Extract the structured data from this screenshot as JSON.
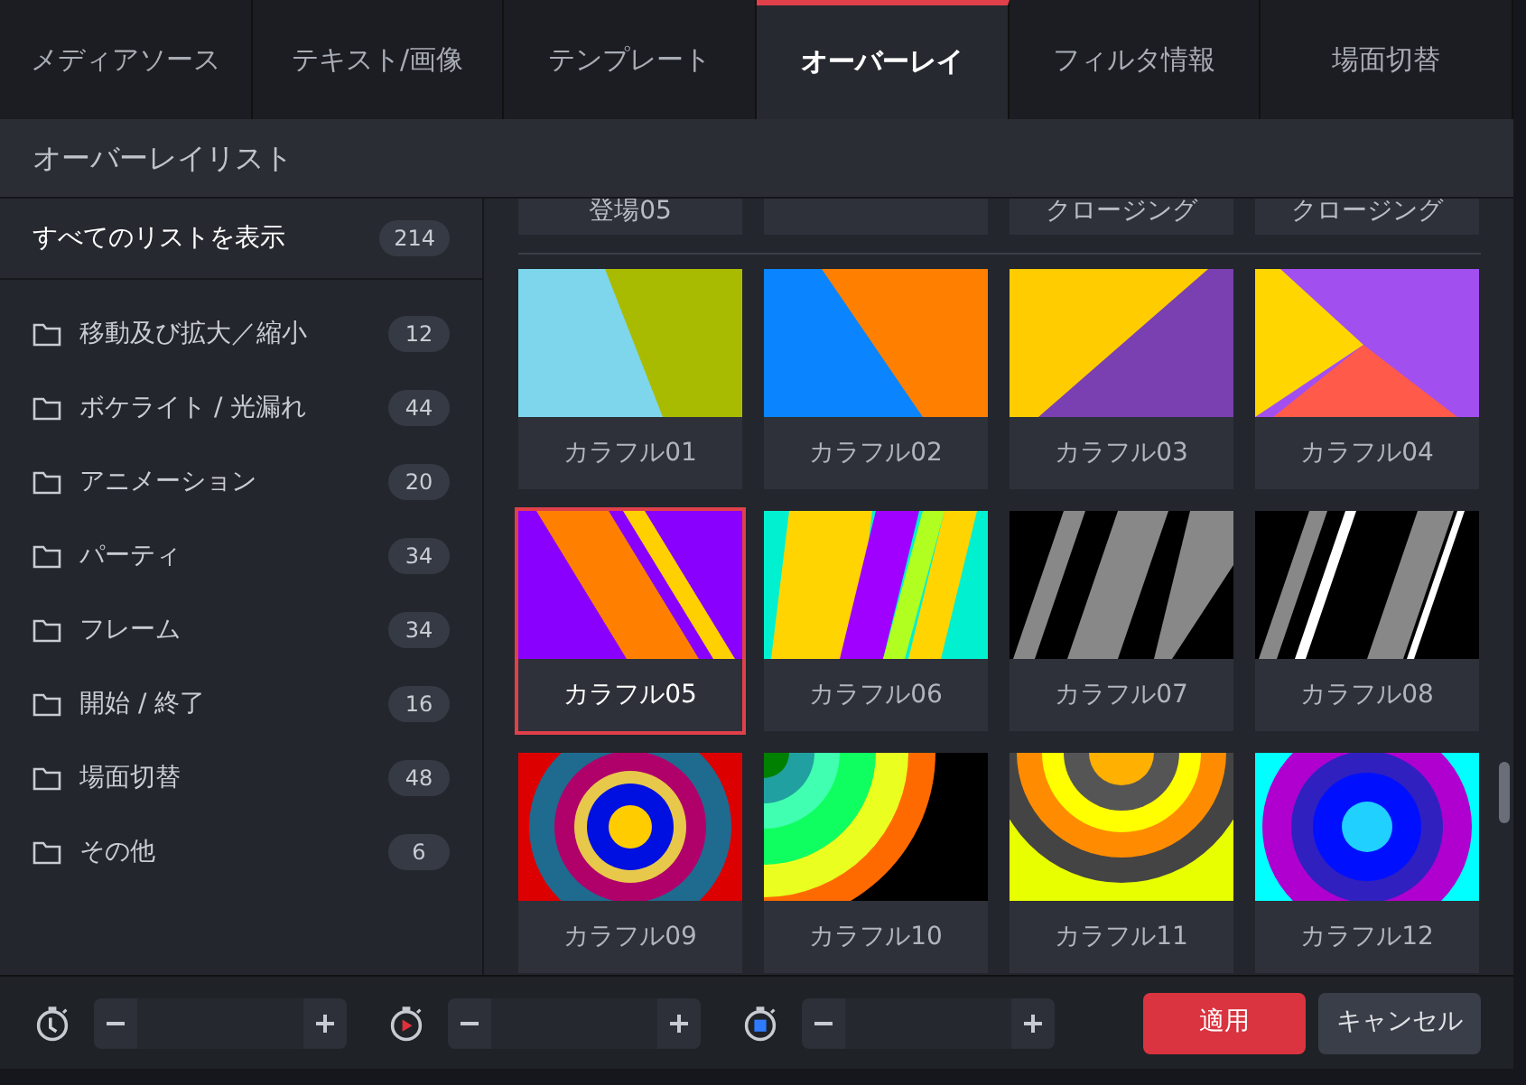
{
  "tabs": [
    {
      "label": "メディアソース",
      "selected": false
    },
    {
      "label": "テキスト/画像",
      "selected": false
    },
    {
      "label": "テンプレート",
      "selected": false
    },
    {
      "label": "オーバーレイ",
      "selected": true
    },
    {
      "label": "フィルタ情報",
      "selected": false
    },
    {
      "label": "場面切替",
      "selected": false
    }
  ],
  "list_header": "オーバーレイリスト",
  "sidebar": {
    "all": {
      "label": "すべてのリストを表示",
      "count": "214",
      "selected": false
    },
    "items": [
      {
        "label": "移動及び拡大／縮小",
        "count": "12"
      },
      {
        "label": "ボケライト / 光漏れ",
        "count": "44"
      },
      {
        "label": "アニメーション",
        "count": "20"
      },
      {
        "label": "パーティ",
        "count": "34"
      },
      {
        "label": "フレーム",
        "count": "34"
      },
      {
        "label": "開始 / 終了",
        "count": "16"
      },
      {
        "label": "場面切替",
        "count": "48"
      },
      {
        "label": "その他",
        "count": "6"
      }
    ]
  },
  "partial_row": [
    {
      "kind": "labeled",
      "label": "登場05"
    },
    {
      "kind": "covered"
    },
    {
      "kind": "labeled",
      "label": "クロージング"
    },
    {
      "kind": "labeled",
      "label": "クロージング"
    }
  ],
  "overlays": [
    {
      "label": "カラフル01",
      "selected": false
    },
    {
      "label": "カラフル02",
      "selected": false
    },
    {
      "label": "カラフル03",
      "selected": false
    },
    {
      "label": "カラフル04",
      "selected": false
    },
    {
      "label": "カラフル05",
      "selected": true
    },
    {
      "label": "カラフル06",
      "selected": false
    },
    {
      "label": "カラフル07",
      "selected": false
    },
    {
      "label": "カラフル08",
      "selected": false
    },
    {
      "label": "カラフル09",
      "selected": false
    },
    {
      "label": "カラフル10",
      "selected": false
    },
    {
      "label": "カラフル11",
      "selected": false
    },
    {
      "label": "カラフル12",
      "selected": false
    }
  ],
  "timers": [
    {
      "kind": "duration"
    },
    {
      "kind": "start"
    },
    {
      "kind": "end"
    }
  ],
  "buttons": {
    "apply": "適用",
    "cancel": "キャンセル"
  }
}
